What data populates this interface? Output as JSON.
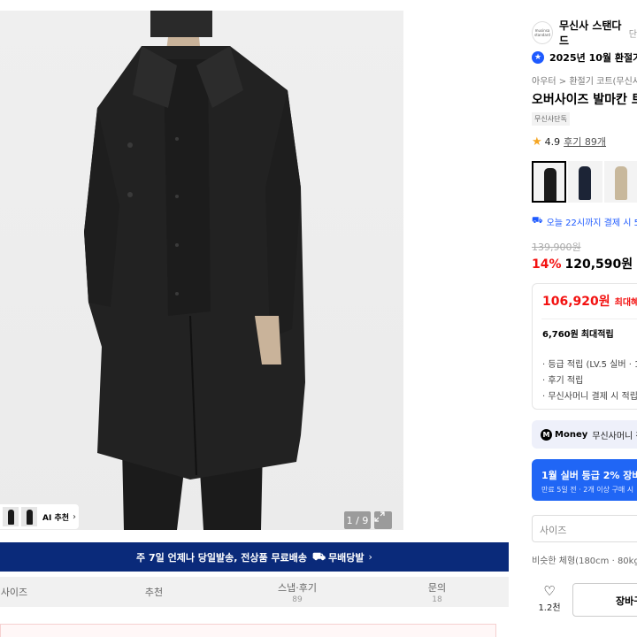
{
  "image": {
    "counter": "1 / 9",
    "ai_recommend_label": "AI 추천"
  },
  "shipping_banner": {
    "text": "주 7일 언제나 당일발송, 전상품 무료배송",
    "free_label": "무배당발"
  },
  "tabs": [
    {
      "label": "사이즈",
      "count": ""
    },
    {
      "label": "추천",
      "count": ""
    },
    {
      "label": "스냅·후기",
      "count": "89"
    },
    {
      "label": "문의",
      "count": "18"
    }
  ],
  "brand": {
    "logo_text": "musinsa standard",
    "name": "무신사 스탠다드",
    "extra": "단"
  },
  "award": {
    "text": "2025년 10월 환절기 코"
  },
  "breadcrumb": "아우터 > 환절기 코트(무신사",
  "product": {
    "name": "오버사이즈 발마칸 트",
    "exclusive_tag": "무신사단독",
    "rating": "4.9",
    "reviews": "후기 89개"
  },
  "delivery_text": "오늘 22시까지 결제 시 5",
  "price": {
    "original": "139,900원",
    "discount": "14%",
    "sale": "120,590원",
    "max_benefit_price": "106,920원",
    "max_benefit_label": "최대혜택",
    "points_value": "6,760원",
    "points_label": "최대적립",
    "lines": [
      "· 등급 적립 (LV.5 실버 · 1.",
      "· 후기 적립",
      "· 무신사머니 결제 시 적립"
    ]
  },
  "money": {
    "icon": "M",
    "word": "Money",
    "text": "무신사머니 첫"
  },
  "coupon": {
    "title": "1월 실버 등급 2% 장바구",
    "sub": "만료 5일 전 · 2개 이상 구매 시"
  },
  "size_select_placeholder": "사이즈",
  "similar_build": "비슷한 체형(180cm · 80kg)",
  "like_count": "1.2천",
  "cart_label": "장바구",
  "colors": {
    "accent_red": "#f31110",
    "accent_blue": "#2066f5",
    "banner_navy": "#0a2a7a"
  }
}
